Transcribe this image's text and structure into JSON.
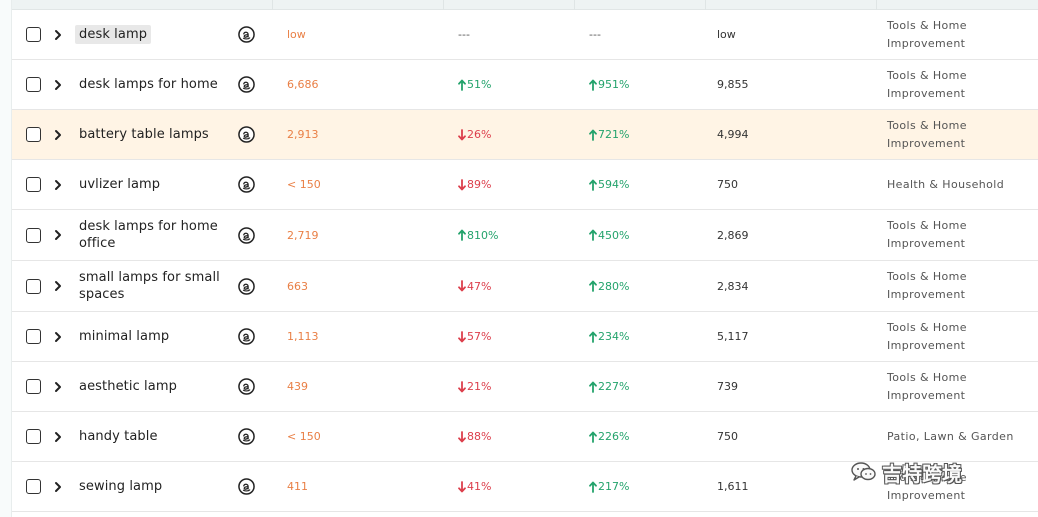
{
  "table": {
    "rows": [
      {
        "keyword": "desk lamp",
        "search_volume": "low",
        "trend_1": {
          "direction": "none",
          "value": "---"
        },
        "trend_2": {
          "direction": "none",
          "value": "---"
        },
        "volume": "low",
        "category": "Tools & Home Improvement",
        "selected_chip": true,
        "highlighted": false
      },
      {
        "keyword": "desk lamps for home",
        "search_volume": "6,686",
        "trend_1": {
          "direction": "up",
          "value": "51%"
        },
        "trend_2": {
          "direction": "up",
          "value": "951%"
        },
        "volume": "9,855",
        "category": "Tools & Home Improvement",
        "selected_chip": false,
        "highlighted": false
      },
      {
        "keyword": "battery table lamps",
        "search_volume": "2,913",
        "trend_1": {
          "direction": "down",
          "value": "26%"
        },
        "trend_2": {
          "direction": "up",
          "value": "721%"
        },
        "volume": "4,994",
        "category": "Tools & Home Improvement",
        "selected_chip": false,
        "highlighted": true
      },
      {
        "keyword": "uvlizer lamp",
        "search_volume": "< 150",
        "trend_1": {
          "direction": "down",
          "value": "89%"
        },
        "trend_2": {
          "direction": "up",
          "value": "594%"
        },
        "volume": "750",
        "category": "Health & Household",
        "selected_chip": false,
        "highlighted": false
      },
      {
        "keyword": "desk lamps for home office",
        "search_volume": "2,719",
        "trend_1": {
          "direction": "up",
          "value": "810%"
        },
        "trend_2": {
          "direction": "up",
          "value": "450%"
        },
        "volume": "2,869",
        "category": "Tools & Home Improvement",
        "selected_chip": false,
        "highlighted": false
      },
      {
        "keyword": "small lamps for small spaces",
        "search_volume": "663",
        "trend_1": {
          "direction": "down",
          "value": "47%"
        },
        "trend_2": {
          "direction": "up",
          "value": "280%"
        },
        "volume": "2,834",
        "category": "Tools & Home Improvement",
        "selected_chip": false,
        "highlighted": false
      },
      {
        "keyword": "minimal lamp",
        "search_volume": "1,113",
        "trend_1": {
          "direction": "down",
          "value": "57%"
        },
        "trend_2": {
          "direction": "up",
          "value": "234%"
        },
        "volume": "5,117",
        "category": "Tools & Home Improvement",
        "selected_chip": false,
        "highlighted": false
      },
      {
        "keyword": "aesthetic lamp",
        "search_volume": "439",
        "trend_1": {
          "direction": "down",
          "value": "21%"
        },
        "trend_2": {
          "direction": "up",
          "value": "227%"
        },
        "volume": "739",
        "category": "Tools & Home Improvement",
        "selected_chip": false,
        "highlighted": false
      },
      {
        "keyword": "handy table",
        "search_volume": "< 150",
        "trend_1": {
          "direction": "down",
          "value": "88%"
        },
        "trend_2": {
          "direction": "up",
          "value": "226%"
        },
        "volume": "750",
        "category": "Patio, Lawn & Garden",
        "selected_chip": false,
        "highlighted": false
      },
      {
        "keyword": "sewing lamp",
        "search_volume": "411",
        "trend_1": {
          "direction": "down",
          "value": "41%"
        },
        "trend_2": {
          "direction": "up",
          "value": "217%"
        },
        "volume": "1,611",
        "category": "Tools & Home Improvement",
        "selected_chip": false,
        "highlighted": false
      }
    ]
  },
  "watermark": {
    "text": "吉特跨境",
    "icon": "wechat-icon"
  },
  "icons": {
    "checkbox": "checkbox-icon",
    "expand": "chevron-right-icon",
    "source": "amazon-icon",
    "up": "arrow-up-icon",
    "down": "arrow-down-icon"
  },
  "colors": {
    "search_volume": "#e97f45",
    "trend_up": "#24a36c",
    "trend_down": "#dc3f4c",
    "highlight_row": "#fff4e5"
  }
}
